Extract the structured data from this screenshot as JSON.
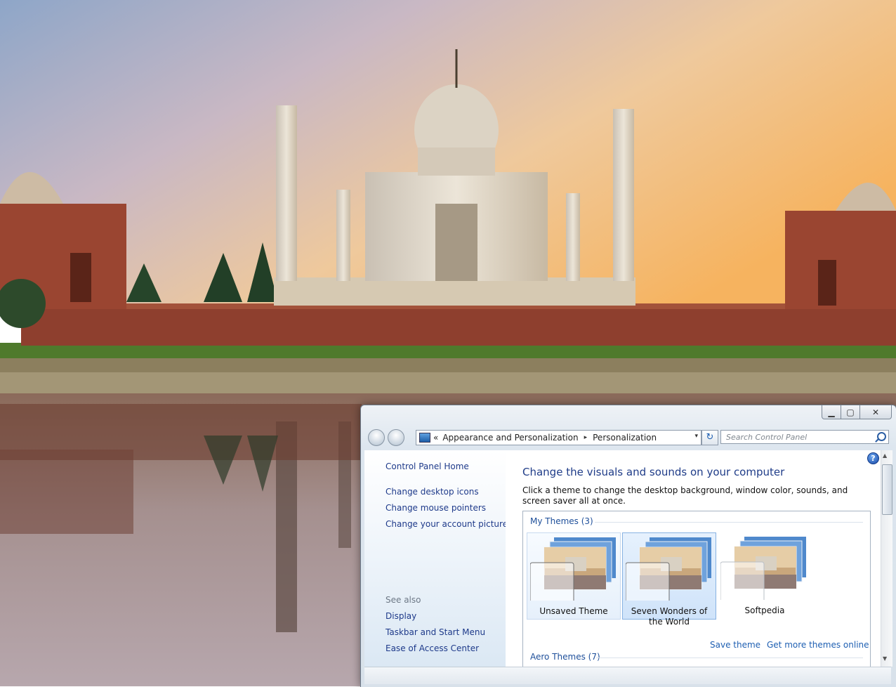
{
  "window": {
    "minimize": "▁",
    "maximize": "▢",
    "close": "✕"
  },
  "address": {
    "overflow": "«",
    "crumb1": "Appearance and Personalization",
    "separator": "▸",
    "crumb2": "Personalization",
    "dropdown": "▾",
    "refresh": "↻"
  },
  "search": {
    "placeholder": "Search Control Panel"
  },
  "sidebar": {
    "home": "Control Panel Home",
    "items": [
      "Change desktop icons",
      "Change mouse pointers",
      "Change your account picture"
    ],
    "see_also_label": "See also",
    "see_also": [
      "Display",
      "Taskbar and Start Menu",
      "Ease of Access Center"
    ]
  },
  "main": {
    "help": "?",
    "heading": "Change the visuals and sounds on your computer",
    "description": "Click a theme to change the desktop background, window color, sounds, and screen saver all at once.",
    "my_themes_label": "My Themes (3)",
    "themes": [
      {
        "name": "Unsaved Theme",
        "state": "hover"
      },
      {
        "name": "Seven Wonders of the World",
        "state": "selected"
      },
      {
        "name": "Softpedia",
        "state": "normal"
      }
    ],
    "save_theme": "Save theme",
    "get_more": "Get more themes online",
    "aero_themes_label": "Aero Themes (7)"
  },
  "colors": {
    "link": "#1e3a8a",
    "heading": "#1f3c88",
    "selection_border": "#87b2e2"
  }
}
